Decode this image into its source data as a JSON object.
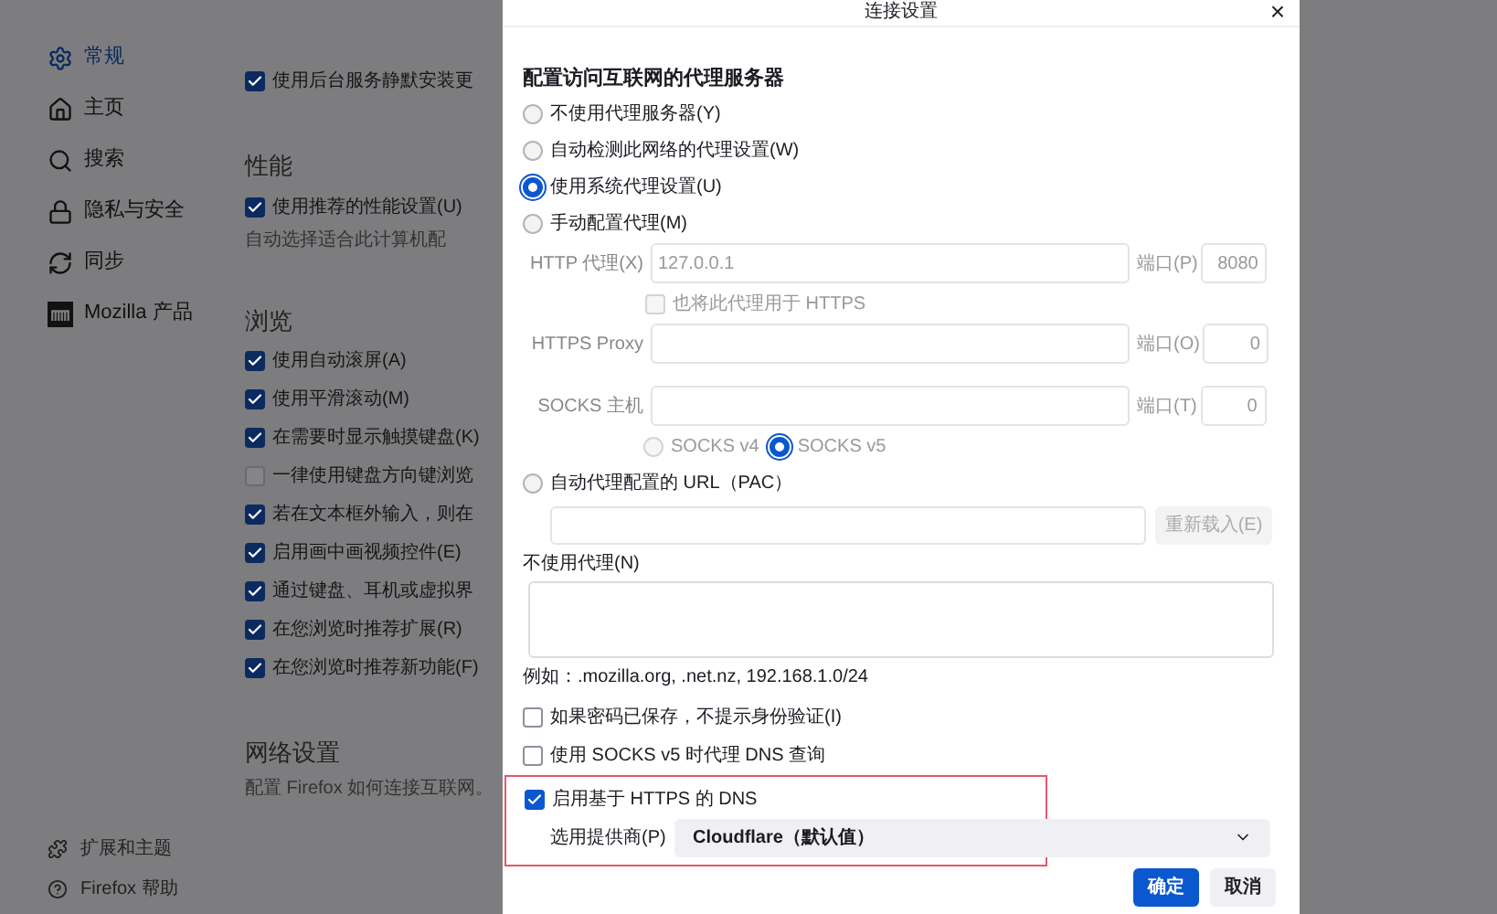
{
  "sidebar": {
    "items": [
      {
        "label": "常规",
        "selected": true
      },
      {
        "label": "主页",
        "selected": false
      },
      {
        "label": "搜索",
        "selected": false
      },
      {
        "label": "隐私与安全",
        "selected": false
      },
      {
        "label": "同步",
        "selected": false
      },
      {
        "label": "Mozilla 产品",
        "selected": false
      }
    ],
    "footer": [
      {
        "label": "扩展和主题"
      },
      {
        "label": "Firefox 帮助"
      }
    ]
  },
  "settings": [
    {
      "kind": "check",
      "label": "使用后台服务静默安装更",
      "checked": true
    },
    {
      "kind": "heading",
      "label": "性能"
    },
    {
      "kind": "check",
      "label": "使用推荐的性能设置(U)",
      "checked": true
    },
    {
      "kind": "note",
      "label": "自动选择适合此计算机配"
    },
    {
      "kind": "heading",
      "label": "浏览"
    },
    {
      "kind": "check",
      "label": "使用自动滚屏(A)",
      "checked": true
    },
    {
      "kind": "check",
      "label": "使用平滑滚动(M)",
      "checked": true
    },
    {
      "kind": "check",
      "label": "在需要时显示触摸键盘(K)",
      "checked": true
    },
    {
      "kind": "check",
      "label": "一律使用键盘方向键浏览",
      "checked": false
    },
    {
      "kind": "check",
      "label": "若在文本框外输入，则在",
      "checked": true
    },
    {
      "kind": "check",
      "label": "启用画中画视频控件(E)",
      "checked": true
    },
    {
      "kind": "check",
      "label": "通过键盘、耳机或虚拟界",
      "checked": true
    },
    {
      "kind": "check",
      "label": "在您浏览时推荐扩展(R)",
      "checked": true
    },
    {
      "kind": "check",
      "label": "在您浏览时推荐新功能(F)",
      "checked": true
    },
    {
      "kind": "heading",
      "label": "网络设置"
    },
    {
      "kind": "note",
      "label": "配置 Firefox 如何连接互联网。"
    }
  ],
  "dialog": {
    "title": "连接设置",
    "close": "×",
    "heading": "配置访问互联网的代理服务器",
    "modes": [
      {
        "label": "不使用代理服务器(Y)",
        "selected": false
      },
      {
        "label": "自动检测此网络的代理设置(W)",
        "selected": false
      },
      {
        "label": "使用系统代理设置(U)",
        "selected": true
      },
      {
        "label": "手动配置代理(M)",
        "selected": false
      }
    ],
    "proxies": [
      {
        "label": "HTTP 代理(X)",
        "value": "127.0.0.1",
        "port_label": "端口(P)",
        "port": "8080"
      },
      {
        "label": "HTTPS Proxy",
        "port_label": "端口(O)",
        "port": "0"
      },
      {
        "label": "SOCKS 主机",
        "port_label": "端口(T)",
        "port": "0"
      }
    ],
    "also_https": {
      "label": "也将此代理用于 HTTPS",
      "checked": false
    },
    "socks_versions": [
      {
        "label": "SOCKS v4",
        "selected": false
      },
      {
        "label": "SOCKS v5",
        "selected": true
      }
    ],
    "pac": {
      "label": "自动代理配置的 URL（PAC）",
      "selected": false,
      "reload": "重新载入(E)"
    },
    "no_proxy": {
      "label": "不使用代理(N)",
      "example": "例如：.mozilla.org, .net.nz, 192.168.1.0/24"
    },
    "options": [
      {
        "label": "如果密码已保存，不提示身份验证(I)",
        "checked": false
      },
      {
        "label": "使用 SOCKS v5 时代理 DNS 查询",
        "checked": false
      }
    ],
    "dns": {
      "highlighted": true,
      "label": "启用基于 HTTPS 的 DNS",
      "checked": true,
      "provider_label": "选用提供商(P)",
      "provider": "Cloudflare（默认值）"
    },
    "buttons": [
      {
        "label": "确定",
        "primary": true
      },
      {
        "label": "取消",
        "primary": false
      }
    ]
  }
}
